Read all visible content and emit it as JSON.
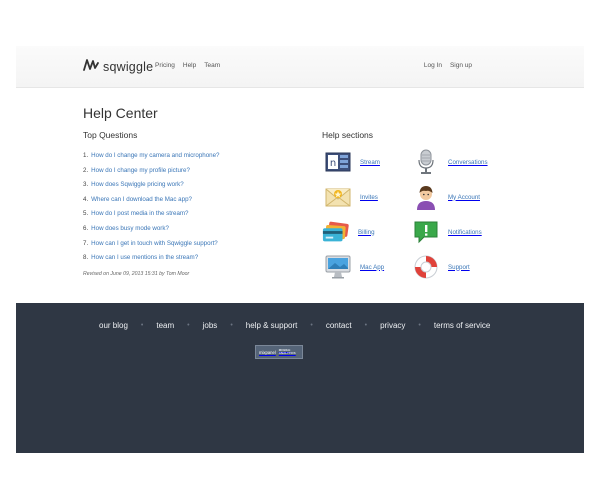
{
  "header": {
    "logo_text": "sqwiggle",
    "nav": [
      "Pricing",
      "Help",
      "Team"
    ],
    "auth": [
      "Log In",
      "Sign up"
    ]
  },
  "main": {
    "title": "Help Center",
    "top_questions_title": "Top Questions",
    "questions": [
      {
        "num": "1.",
        "text": "How do I change my camera and microphone?"
      },
      {
        "num": "2.",
        "text": "How do I change my profile picture?"
      },
      {
        "num": "3.",
        "text": "How does Sqwiggle pricing work?"
      },
      {
        "num": "4.",
        "text": "Where can I download the Mac app?"
      },
      {
        "num": "5.",
        "text": "How do I post media in the stream?"
      },
      {
        "num": "6.",
        "text": "How does busy mode work?"
      },
      {
        "num": "7.",
        "text": "How can I get in touch with Sqwiggle support?"
      },
      {
        "num": "8.",
        "text": "How can I use mentions in the stream?"
      }
    ],
    "revised": "Revised on June 09, 2013 15:31 by Tom Moor",
    "help_sections_title": "Help sections",
    "sections": [
      {
        "label": "Stream",
        "icon": "stream-icon"
      },
      {
        "label": "Conversations",
        "icon": "microphone-icon"
      },
      {
        "label": "Invites",
        "icon": "envelope-icon"
      },
      {
        "label": "My Account",
        "icon": "user-icon"
      },
      {
        "label": "Billing",
        "icon": "credit-cards-icon"
      },
      {
        "label": "Notifications",
        "icon": "speech-bubble-icon"
      },
      {
        "label": "Mac App",
        "icon": "imac-icon"
      },
      {
        "label": "Support",
        "icon": "lifebuoy-icon"
      }
    ]
  },
  "footer": {
    "links": [
      "our blog",
      "team",
      "jobs",
      "help & support",
      "contact",
      "privacy",
      "terms of service"
    ],
    "badge_line1": "mixpanel",
    "badge_line2a": "MOBILE",
    "badge_line2b": "ANALYTICS"
  }
}
